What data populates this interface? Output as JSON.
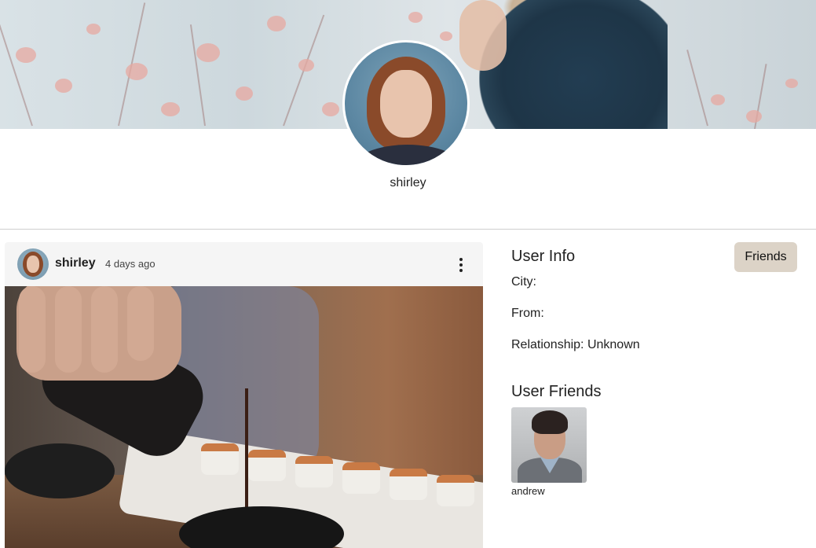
{
  "profile": {
    "username": "shirley"
  },
  "post": {
    "author": "shirley",
    "time": "4 days ago"
  },
  "user_info": {
    "title": "User Info",
    "friends_button": "Friends",
    "city_label": "City:",
    "from_label": "From:",
    "relationship_label": "Relationship: Unknown"
  },
  "user_friends": {
    "title": "User Friends",
    "items": [
      {
        "name": "andrew"
      }
    ]
  },
  "colors": {
    "friends_button_bg": "#dcd3c7",
    "divider": "#cfcfcf",
    "post_card_bg": "#f5f5f5"
  },
  "icons": {
    "post_menu": "more-vertical-icon"
  }
}
